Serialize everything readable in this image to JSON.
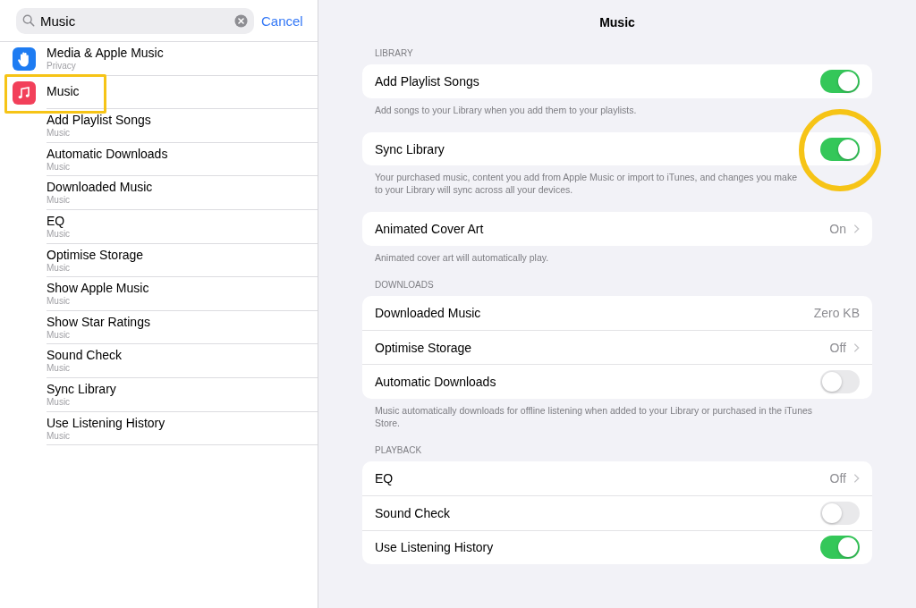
{
  "search": {
    "value": "Music",
    "cancel": "Cancel"
  },
  "results": [
    {
      "title": "Media & Apple Music",
      "subtitle": "Privacy",
      "kind": "app",
      "highlighted": false
    },
    {
      "title": "Music",
      "kind": "app",
      "highlighted": true
    },
    {
      "title": "Add Playlist Songs",
      "subtitle": "Music",
      "highlighted": false
    },
    {
      "title": "Automatic Downloads",
      "subtitle": "Music",
      "highlighted": false
    },
    {
      "title": "Downloaded Music",
      "subtitle": "Music",
      "highlighted": false
    },
    {
      "title": "EQ",
      "subtitle": "Music",
      "highlighted": false
    },
    {
      "title": "Optimise Storage",
      "subtitle": "Music",
      "highlighted": false
    },
    {
      "title": "Show Apple Music",
      "subtitle": "Music",
      "highlighted": false
    },
    {
      "title": "Show Star Ratings",
      "subtitle": "Music",
      "highlighted": false
    },
    {
      "title": "Sound Check",
      "subtitle": "Music",
      "highlighted": false
    },
    {
      "title": "Sync Library",
      "subtitle": "Music",
      "highlighted": false
    },
    {
      "title": "Use Listening History",
      "subtitle": "Music",
      "highlighted": false
    }
  ],
  "nav_title": "Music",
  "groups": [
    {
      "header": "LIBRARY",
      "rows": [
        {
          "label": "Add Playlist Songs",
          "kind": "toggle",
          "on": true,
          "highlighted": false
        }
      ],
      "footer": "Add songs to your Library when you add them to your playlists."
    },
    {
      "rows": [
        {
          "label": "Sync Library",
          "kind": "toggle",
          "on": true,
          "highlighted": true
        }
      ],
      "footer": "Your purchased music, content you add from Apple Music or import to iTunes, and changes you make to your Library will sync across all your devices."
    },
    {
      "rows": [
        {
          "label": "Animated Cover Art",
          "kind": "disclosure",
          "value": "On"
        }
      ],
      "footer": "Animated cover art will automatically play."
    },
    {
      "header": "DOWNLOADS",
      "rows": [
        {
          "label": "Downloaded Music",
          "kind": "value",
          "value": "Zero KB"
        },
        {
          "label": "Optimise Storage",
          "kind": "disclosure",
          "value": "Off"
        },
        {
          "label": "Automatic Downloads",
          "kind": "toggle",
          "on": false,
          "highlighted": false
        }
      ],
      "footer": "Music automatically downloads for offline listening when added to your Library or purchased in the iTunes Store."
    },
    {
      "header": "PLAYBACK",
      "rows": [
        {
          "label": "EQ",
          "kind": "disclosure",
          "value": "Off"
        },
        {
          "label": "Sound Check",
          "kind": "toggle",
          "on": false,
          "highlighted": false
        },
        {
          "label": "Use Listening History",
          "kind": "toggle",
          "on": true,
          "highlighted": false
        }
      ]
    }
  ]
}
